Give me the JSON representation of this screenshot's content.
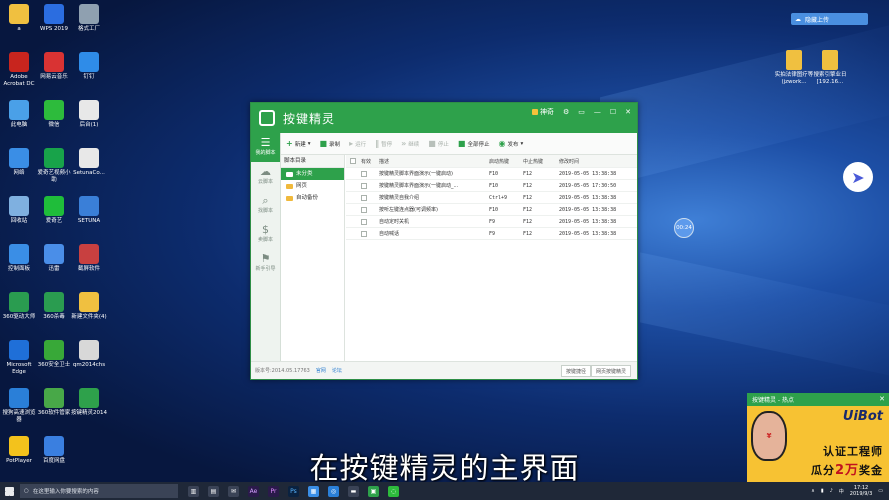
{
  "desktop": {
    "left_icons": [
      {
        "label": "a",
        "color": "#f0c040"
      },
      {
        "label": "WPS 2019",
        "color": "#2b6de0"
      },
      {
        "label": "格式工厂",
        "color": "#8fa0b0"
      },
      {
        "label": "Adobe Acrobat DC",
        "color": "#c8251e"
      },
      {
        "label": "网易云音乐",
        "color": "#d93333"
      },
      {
        "label": "钉钉",
        "color": "#2f8ce8"
      },
      {
        "label": "此电脑",
        "color": "#4aa0e8"
      },
      {
        "label": "微信",
        "color": "#2dbb3c"
      },
      {
        "label": "后台(1)",
        "color": "#e8e8e8"
      },
      {
        "label": "网络",
        "color": "#3a8ee6"
      },
      {
        "label": "爱奇艺视频小助",
        "color": "#18a34a"
      },
      {
        "label": "SetunaCo...",
        "color": "#e8e8e8"
      },
      {
        "label": "回收站",
        "color": "#7fb0e0"
      },
      {
        "label": "爱奇艺",
        "color": "#1fbd3a"
      },
      {
        "label": "SETUNA",
        "color": "#3a7fd8"
      },
      {
        "label": "控制面板",
        "color": "#3a8ee6"
      },
      {
        "label": "迅雷",
        "color": "#4a8ee8"
      },
      {
        "label": "截屏软件",
        "color": "#c84040"
      },
      {
        "label": "360驱动大师",
        "color": "#2a9c50"
      },
      {
        "label": "360杀毒",
        "color": "#2a9c50"
      },
      {
        "label": "新建文件夹(4)",
        "color": "#f0c040"
      },
      {
        "label": "Microsoft Edge",
        "color": "#1f6fd8"
      },
      {
        "label": "360安全卫士",
        "color": "#38a838"
      },
      {
        "label": "qm2014chs",
        "color": "#d8d8d8"
      },
      {
        "label": "搜狗高速浏览器",
        "color": "#2a7fd8"
      },
      {
        "label": "360软件管家",
        "color": "#48a848"
      },
      {
        "label": "按键精灵2014",
        "color": "#2ea14b"
      },
      {
        "label": "PotPlayer",
        "color": "#f3c21c"
      },
      {
        "label": "百度网盘",
        "color": "#3a7fe0"
      }
    ],
    "right_icons": [
      {
        "label": "实拍法律图疗等 (jzwork..."
      },
      {
        "label": "搜索引擎业日 [192.16..."
      }
    ],
    "baidu_btn": "隐藏上传",
    "timer": "00:24"
  },
  "app": {
    "title": "按键精灵",
    "user": "神奇",
    "sidebar": [
      {
        "icon": "☰",
        "label": "我的脚本"
      },
      {
        "icon": "☁",
        "label": "云脚本"
      },
      {
        "icon": "⌕",
        "label": "找脚本"
      },
      {
        "icon": "$",
        "label": "卖脚本"
      },
      {
        "icon": "⚑",
        "label": "新手引导"
      }
    ],
    "toolbar": [
      "新建",
      "录制",
      "运行",
      "暂停",
      "继续",
      "停止",
      "全部停止",
      "发布"
    ],
    "tree": {
      "header": "脚本目录",
      "items": [
        "未分类",
        "网页",
        "自动备份"
      ]
    },
    "columns": [
      "有效",
      "描述",
      "启动热键",
      "中止热键",
      "修改时间"
    ],
    "rows": [
      {
        "desc": "按键精灵脚本界面演示(一键启动)",
        "start": "F10",
        "stop": "F12",
        "time": "2019-05-05 13:38:38"
      },
      {
        "desc": "按键精灵脚本界面演示(一键启动_...",
        "start": "F10",
        "stop": "F12",
        "time": "2019-05-05 17:30:50"
      },
      {
        "desc": "按键精灵自我介绍",
        "start": "Ctrl+9",
        "stop": "F12",
        "time": "2019-05-05 13:38:38"
      },
      {
        "desc": "按听左键连点器(可调频率)",
        "start": "F10",
        "stop": "F12",
        "time": "2019-05-05 13:38:38"
      },
      {
        "desc": "自动定时关机",
        "start": "F9",
        "stop": "F12",
        "time": "2019-05-05 13:38:38"
      },
      {
        "desc": "自动喊话",
        "start": "F9",
        "stop": "F12",
        "time": "2019-05-05 13:38:38"
      }
    ],
    "status": {
      "version": "版本号:2014.05.17763",
      "link1": "官网",
      "link2": "论坛",
      "btn1": "按键捷径",
      "btn2": "网页按键精灵"
    }
  },
  "subtitle": "在按键精灵的主界面",
  "ad": {
    "header": "按键精灵 - 热点",
    "brand": "UiBot",
    "line1": "认证工程师",
    "line2a": "瓜分",
    "line2b": "2万",
    "line2c": "奖金"
  },
  "taskbar": {
    "search": "在这里输入你要搜索的内容",
    "time": "17:12",
    "date": "2019/9/3",
    "lang": "中"
  }
}
